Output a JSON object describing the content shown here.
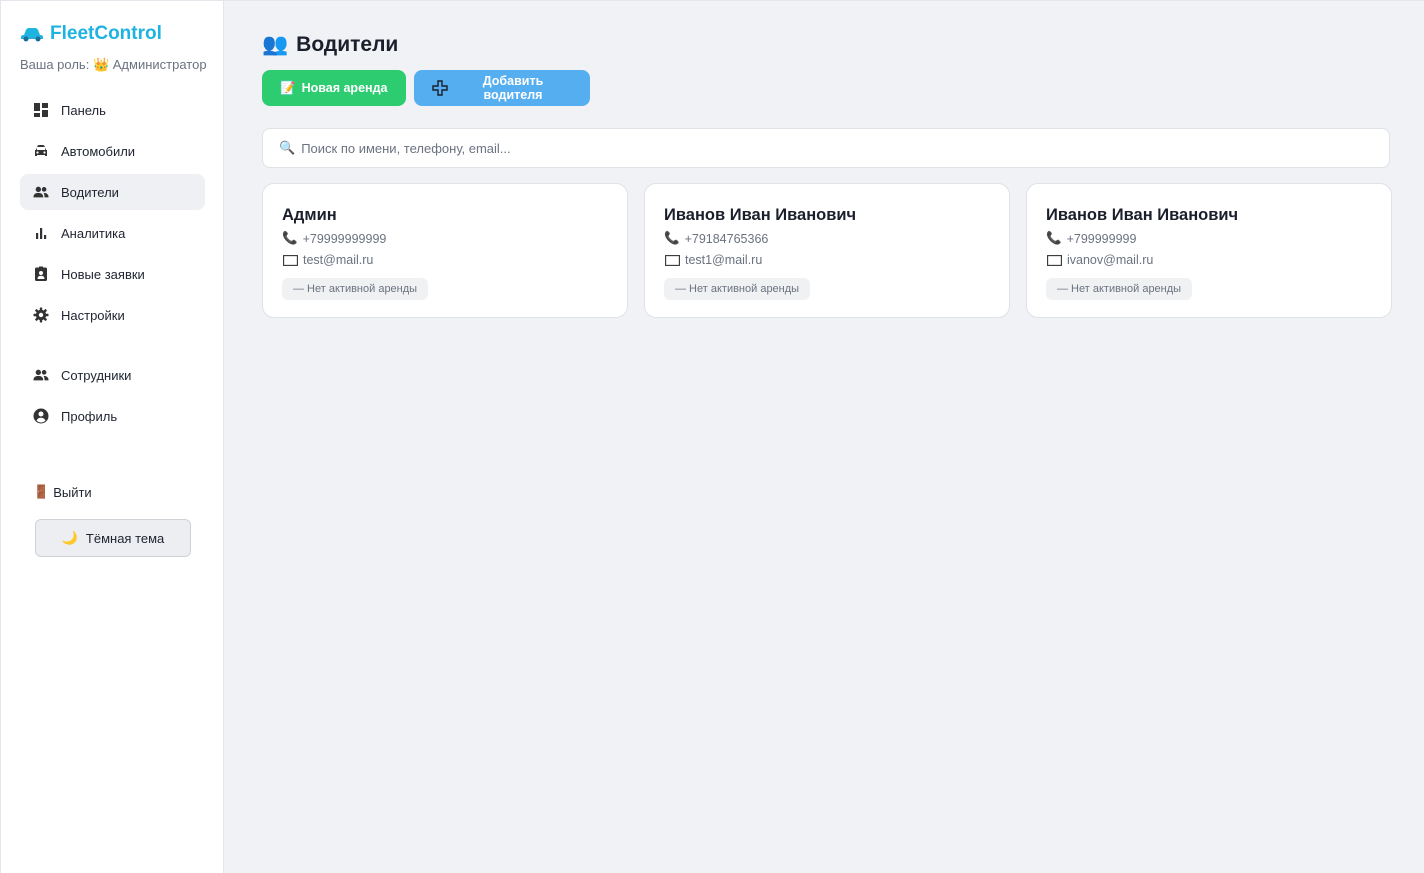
{
  "brand": {
    "name": "FleetControl",
    "icon": "car-icon",
    "color": "#1fb3e0"
  },
  "role": {
    "label": "Ваша роль:",
    "value": "Администратор",
    "icon": "crown-icon"
  },
  "nav": {
    "items": [
      {
        "label": "Панель",
        "icon": "dashboard-icon"
      },
      {
        "label": "Автомобили",
        "icon": "car-icon"
      },
      {
        "label": "Водители",
        "icon": "people-icon",
        "active": true
      },
      {
        "label": "Аналитика",
        "icon": "bar-chart-icon"
      },
      {
        "label": "Новые заявки",
        "icon": "badge-icon"
      },
      {
        "label": "Настройки",
        "icon": "gear-icon"
      }
    ],
    "secondary": [
      {
        "label": "Сотрудники",
        "icon": "people-icon"
      },
      {
        "label": "Профиль",
        "icon": "account-circle-icon"
      }
    ]
  },
  "logout": {
    "label": "Выйти",
    "icon": "door-icon"
  },
  "theme_toggle": {
    "label": "Тёмная тема",
    "icon": "moon-icon"
  },
  "page": {
    "title": "Водители",
    "icon": "busts-icon"
  },
  "actions": {
    "new_rental": {
      "label": "Новая аренда",
      "icon": "memo-icon",
      "color": "#2ecc71"
    },
    "add_driver": {
      "label": "Добавить водителя",
      "icon": "plus-icon",
      "color": "#55aef0"
    }
  },
  "search": {
    "placeholder": "Поиск по имени, телефону, email...",
    "value": "",
    "icon": "search-icon"
  },
  "drivers": [
    {
      "name": "Админ",
      "phone": "+79999999999",
      "email": "test@mail.ru",
      "status": "— Нет активной аренды"
    },
    {
      "name": "Иванов Иван Иванович",
      "phone": "+79184765366",
      "email": "test1@mail.ru",
      "status": "— Нет активной аренды"
    },
    {
      "name": "Иванов Иван Иванович",
      "phone": "+799999999",
      "email": "ivanov@mail.ru",
      "status": "— Нет активной аренды"
    }
  ]
}
